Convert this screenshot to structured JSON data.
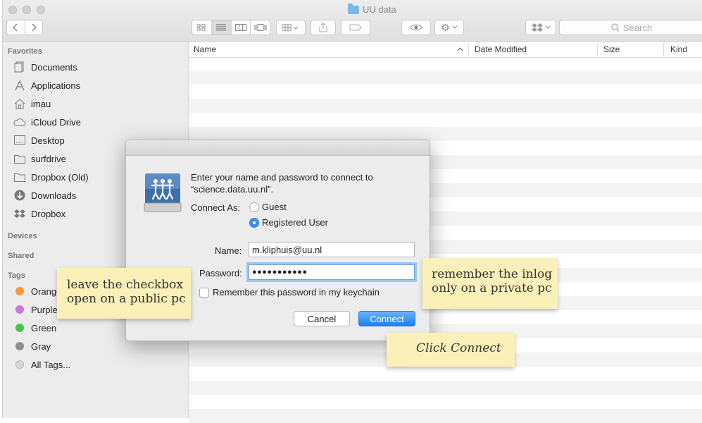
{
  "window": {
    "title": "UU data",
    "search_placeholder": "Search"
  },
  "sidebar": {
    "favorites_label": "Favorites",
    "favorites": [
      {
        "label": "Documents",
        "icon": "documents-icon"
      },
      {
        "label": "Applications",
        "icon": "applications-icon"
      },
      {
        "label": "imau",
        "icon": "home-icon"
      },
      {
        "label": "iCloud Drive",
        "icon": "cloud-icon"
      },
      {
        "label": "Desktop",
        "icon": "desktop-icon"
      },
      {
        "label": "surfdrive",
        "icon": "folder-icon"
      },
      {
        "label": "Dropbox (Old)",
        "icon": "folder-icon"
      },
      {
        "label": "Downloads",
        "icon": "downloads-icon"
      },
      {
        "label": "Dropbox",
        "icon": "dropbox-icon"
      }
    ],
    "devices_label": "Devices",
    "shared_label": "Shared",
    "tags_label": "Tags",
    "tags": [
      {
        "label": "Orange",
        "color": "#f39a3a"
      },
      {
        "label": "Purple",
        "color": "#c77ad6"
      },
      {
        "label": "Green",
        "color": "#4ac34a"
      },
      {
        "label": "Gray",
        "color": "#8e8e8e"
      },
      {
        "label": "All Tags...",
        "color": "#d8d8d8"
      }
    ]
  },
  "list": {
    "columns": [
      "Name",
      "Date Modified",
      "Size",
      "Kind"
    ]
  },
  "dialog": {
    "message_line1": "Enter your name and password to connect to",
    "message_line2": "“science.data.uu.nl”.",
    "connect_as_label": "Connect As:",
    "option_guest": "Guest",
    "option_registered": "Registered User",
    "name_label": "Name:",
    "name_value": "m.kliphuis@uu.nl",
    "password_label": "Password:",
    "password_value": "●●●●●●●●●●●",
    "remember_label": "Remember this password in my keychain",
    "cancel_label": "Cancel",
    "connect_label": "Connect"
  },
  "annotations": {
    "checkbox_note_line1": "leave the checkbox",
    "checkbox_note_line2": "open on a public pc",
    "remember_note_line1": "remember the inlog",
    "remember_note_line2": "only on a private pc",
    "connect_note": "Click Connect"
  },
  "colors": {
    "accent": "#1f7ef2",
    "note": "#fbf0b8"
  }
}
